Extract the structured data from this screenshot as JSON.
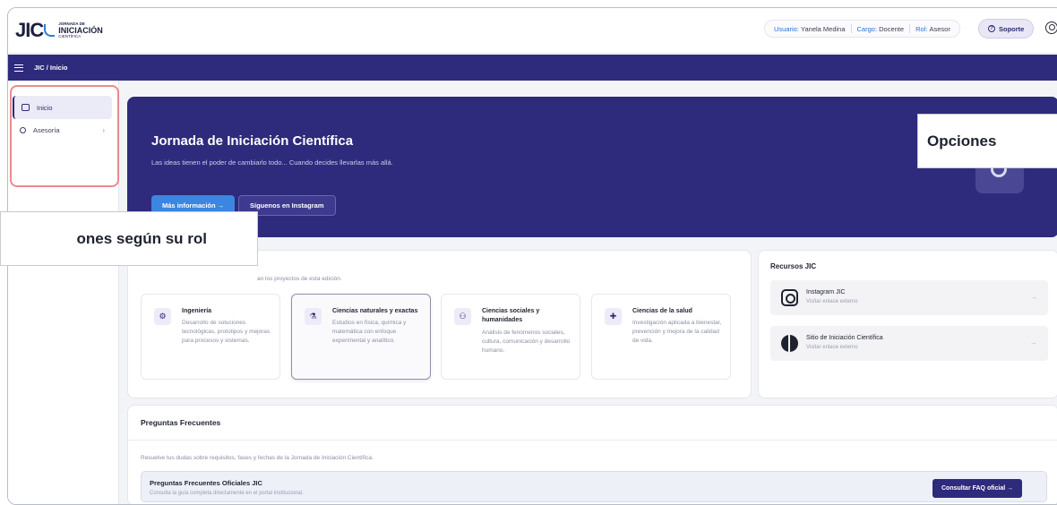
{
  "logo": {
    "mark": "JIC",
    "line1": "JORNADA DE",
    "line2": "INICIACIÓN",
    "line3": "CIENTÍFICA"
  },
  "header": {
    "user_key": "Usuario:",
    "user_val": "Yanela Medina",
    "cargo_key": "Cargo:",
    "cargo_val": "Docente",
    "rol_key": "Rol:",
    "rol_val": "Asesor",
    "support_label": "Soporte"
  },
  "nav": {
    "breadcrumb": "JIC / Inicio"
  },
  "sidebar": {
    "items": [
      {
        "label": "Inicio"
      },
      {
        "label": "Asesoría"
      }
    ]
  },
  "hero": {
    "title": "Jornada de Iniciación Científica",
    "subtitle": "Las ideas tienen el poder de cambiarlo todo... Cuando decides llevarlas más allá.",
    "btn_more": "Más información →",
    "btn_instagram": "Síguenos en Instagram"
  },
  "callouts": {
    "right": "Opciones",
    "left": "ones según su rol"
  },
  "areas": {
    "desc": "an los proyectos de esta edición.",
    "items": [
      {
        "title": "Ingeniería",
        "desc": "Desarrollo de soluciones tecnológicas, prototipos y mejoras para procesos y sistemas.",
        "icon": "⚙"
      },
      {
        "title": "Ciencias naturales y exactas",
        "desc": "Estudios en física, química y matemática con enfoque experimental y analítico.",
        "icon": "⚗"
      },
      {
        "title": "Ciencias sociales y humanidades",
        "desc": "Análisis de fenómenos sociales, cultura, comunicación y desarrollo humano.",
        "icon": "⚇"
      },
      {
        "title": "Ciencias de la salud",
        "desc": "Investigación aplicada a bienestar, prevención y mejora de la calidad de vida.",
        "icon": "✚"
      }
    ]
  },
  "resources": {
    "title": "Recursos JIC",
    "items": [
      {
        "name": "Instagram JIC",
        "sub": "Visitar enlace externo"
      },
      {
        "name": "Sitio de Iniciación Científica",
        "sub": "Visitar enlace externo"
      }
    ],
    "arrow": "→"
  },
  "faq": {
    "title": "Preguntas Frecuentes",
    "desc": "Resuelve tus dudas sobre requisitos, fases y fechas de la Jornada de Iniciación Científica.",
    "box_title": "Preguntas Frecuentes Oficiales JIC",
    "box_sub": "Consulta la guía completa directamente en el portal institucional.",
    "button": "Consultar FAQ oficial →"
  }
}
